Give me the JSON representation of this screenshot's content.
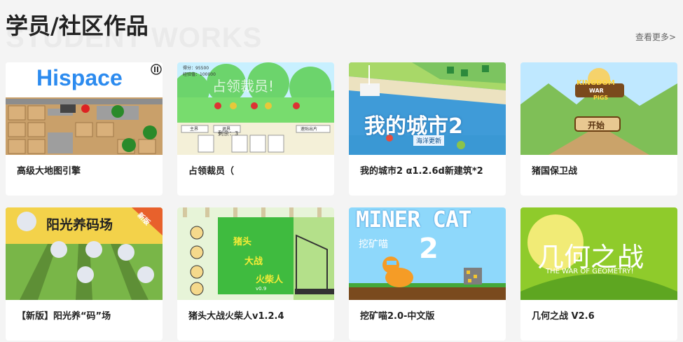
{
  "header": {
    "title": "学员/社区作品",
    "watermark": "STUDENT WORKS",
    "more": "查看更多>"
  },
  "projects": [
    {
      "title": "高级大地图引擎",
      "art": {
        "logo": "Hispace"
      }
    },
    {
      "title": "占领裁员（",
      "art": {
        "score": "得分：95500",
        "exp": "经验值：100000",
        "banner": "占领裁员!",
        "left": "剩余：3",
        "btn1": "主界",
        "btn2": "退界",
        "btn3": "速贴出片"
      }
    },
    {
      "title": "我的城市2 α1.2.6d新建筑*2",
      "art": {
        "logo": "我的城市2",
        "sub": "海洋更新"
      }
    },
    {
      "title": "猪国保卫战",
      "art": {
        "logo_line1": "KINGDOM",
        "logo_line2": "WAR",
        "logo_line3": "PIGS",
        "start": "开始"
      }
    },
    {
      "title": "【新版】阳光养“码”场",
      "art": {
        "logo": "阳光养码场",
        "ribbon": "新版"
      }
    },
    {
      "title": "猪头大战火柴人v1.2.4",
      "art": {
        "line1": "猪头",
        "line2": "大战",
        "line3": "火柴人",
        "ver": "v0.9"
      }
    },
    {
      "title": "挖矿喵2.0-中文版",
      "art": {
        "logo": "MINER CAT",
        "sub": "挖矿喵",
        "num": "2"
      }
    },
    {
      "title": "几何之战 V2.6",
      "art": {
        "logo": "几何之战",
        "sub": "THE WAR OF GEOMETRY!"
      }
    }
  ]
}
